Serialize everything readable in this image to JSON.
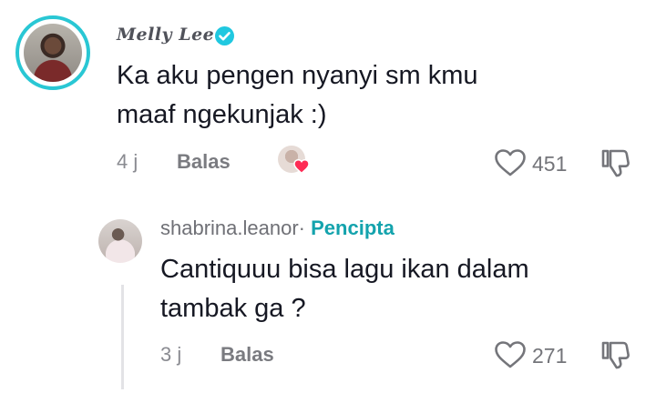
{
  "comment": {
    "author": "Melly Lee",
    "text_line1": "Ka aku pengen nyanyi sm kmu",
    "text_line2": "maaf ngekunjak :)",
    "time": "4 j",
    "reply_label": "Balas",
    "like_count": "451",
    "verified": true,
    "accent_color": "#20c8e0"
  },
  "reply": {
    "author": "shabrina.leanor",
    "separator": "·",
    "badge": "Pencipta",
    "text_line1": "Cantiquuu bisa lagu ikan dalam",
    "text_line2": "tambak ga ?",
    "time": "3 j",
    "reply_label": "Balas",
    "like_count": "271",
    "badge_color": "#14a3ad"
  },
  "icons": [
    "heart-outline-icon",
    "dislike-icon",
    "creator-liked-icon",
    "verified-check-icon"
  ]
}
